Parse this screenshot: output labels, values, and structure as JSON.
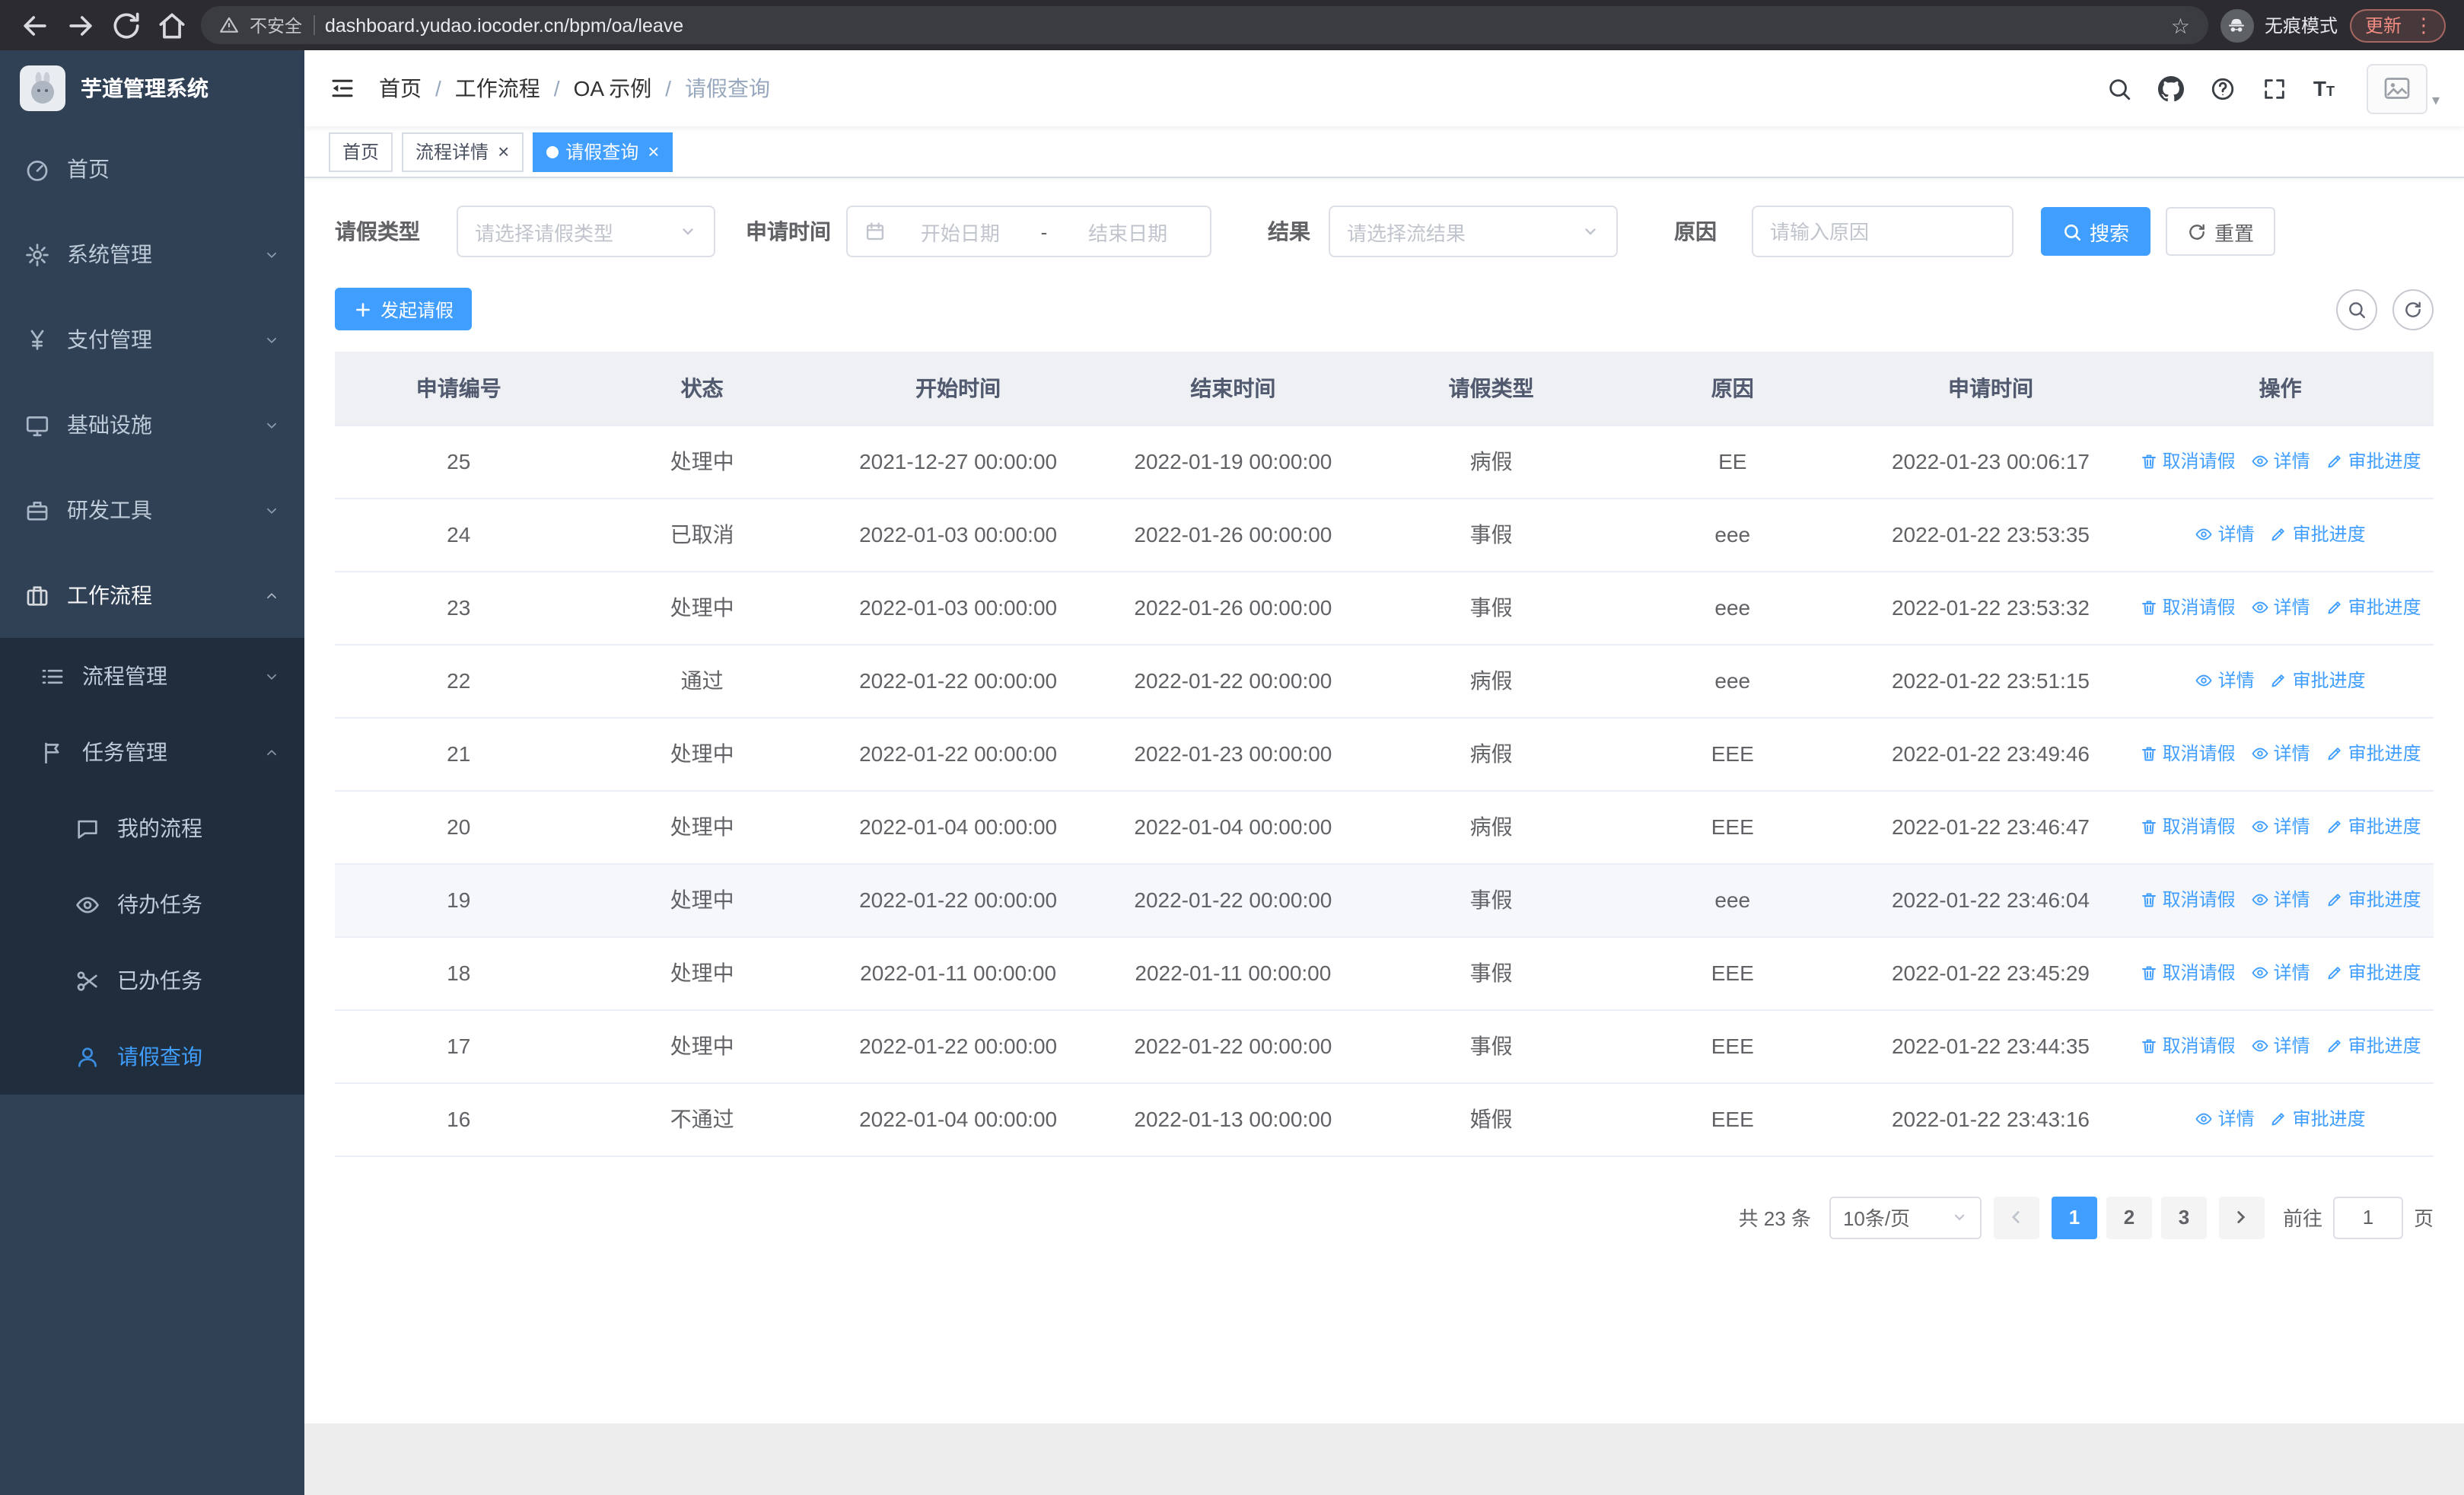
{
  "colors": {
    "accent": "#409eff",
    "sidebar_bg": "#304156",
    "sidebar_submenu_bg": "#1f2d3d",
    "update_pill": "#f28b82"
  },
  "browser": {
    "security_warning": "不安全",
    "url": "dashboard.yudao.iocoder.cn/bpm/oa/leave",
    "incognito_label": "无痕模式",
    "update_label": "更新"
  },
  "sidebar": {
    "logo_title": "芋道管理系统",
    "items": [
      {
        "icon": "dashboard",
        "label": "首页",
        "level": 1
      },
      {
        "icon": "gear",
        "label": "系统管理",
        "level": 1,
        "chevron": "down"
      },
      {
        "icon": "yen",
        "label": "支付管理",
        "level": 1,
        "chevron": "down"
      },
      {
        "icon": "monitor",
        "label": "基础设施",
        "level": 1,
        "chevron": "down"
      },
      {
        "icon": "tools",
        "label": "研发工具",
        "level": 1,
        "chevron": "down"
      },
      {
        "icon": "suitcase",
        "label": "工作流程",
        "level": 1,
        "chevron": "up",
        "parent_active": true
      },
      {
        "icon": "list",
        "label": "流程管理",
        "level": 2,
        "chevron": "down",
        "sub": true
      },
      {
        "icon": "flag",
        "label": "任务管理",
        "level": 2,
        "chevron": "up",
        "sub": true
      },
      {
        "icon": "chat",
        "label": "我的流程",
        "level": 3,
        "sub": true
      },
      {
        "icon": "eye",
        "label": "待办任务",
        "level": 3,
        "sub": true
      },
      {
        "icon": "scissors",
        "label": "已办任务",
        "level": 3,
        "sub": true
      },
      {
        "icon": "user",
        "label": "请假查询",
        "level": 3,
        "sub": true,
        "active": true
      }
    ]
  },
  "header": {
    "breadcrumb": [
      "首页",
      "工作流程",
      "OA 示例",
      "请假查询"
    ],
    "icons": [
      "search-icon",
      "github-icon",
      "question-icon",
      "fullscreen-icon",
      "font-size-icon",
      "avatar-placeholder"
    ]
  },
  "tabs": [
    {
      "label": "首页",
      "closable": false,
      "active": false
    },
    {
      "label": "流程详情",
      "closable": true,
      "active": false
    },
    {
      "label": "请假查询",
      "closable": true,
      "active": true
    }
  ],
  "filters": {
    "leave_type_label": "请假类型",
    "leave_type_placeholder": "请选择请假类型",
    "apply_time_label": "申请时间",
    "start_date_placeholder": "开始日期",
    "range_separator": "-",
    "end_date_placeholder": "结束日期",
    "result_label": "结果",
    "result_placeholder": "请选择流结果",
    "reason_label": "原因",
    "reason_placeholder": "请输入原因",
    "search_label": "搜索",
    "reset_label": "重置"
  },
  "toolbar": {
    "create_label": "发起请假"
  },
  "table": {
    "columns": [
      "申请编号",
      "状态",
      "开始时间",
      "结束时间",
      "请假类型",
      "原因",
      "申请时间",
      "操作"
    ],
    "rows": [
      {
        "id": "25",
        "status": "处理中",
        "start": "2021-12-27 00:00:00",
        "end": "2022-01-19 00:00:00",
        "type": "病假",
        "reason": "EE",
        "apply_time": "2022-01-23 00:06:17",
        "actions": [
          {
            "label": "取消请假",
            "icon": "delete"
          },
          {
            "label": "详情",
            "icon": "view"
          },
          {
            "label": "审批进度",
            "icon": "edit"
          }
        ]
      },
      {
        "id": "24",
        "status": "已取消",
        "start": "2022-01-03 00:00:00",
        "end": "2022-01-26 00:00:00",
        "type": "事假",
        "reason": "eee",
        "apply_time": "2022-01-22 23:53:35",
        "actions": [
          {
            "label": "详情",
            "icon": "view"
          },
          {
            "label": "审批进度",
            "icon": "edit"
          }
        ]
      },
      {
        "id": "23",
        "status": "处理中",
        "start": "2022-01-03 00:00:00",
        "end": "2022-01-26 00:00:00",
        "type": "事假",
        "reason": "eee",
        "apply_time": "2022-01-22 23:53:32",
        "actions": [
          {
            "label": "取消请假",
            "icon": "delete"
          },
          {
            "label": "详情",
            "icon": "view"
          },
          {
            "label": "审批进度",
            "icon": "edit"
          }
        ]
      },
      {
        "id": "22",
        "status": "通过",
        "start": "2022-01-22 00:00:00",
        "end": "2022-01-22 00:00:00",
        "type": "病假",
        "reason": "eee",
        "apply_time": "2022-01-22 23:51:15",
        "actions": [
          {
            "label": "详情",
            "icon": "view"
          },
          {
            "label": "审批进度",
            "icon": "edit"
          }
        ]
      },
      {
        "id": "21",
        "status": "处理中",
        "start": "2022-01-22 00:00:00",
        "end": "2022-01-23 00:00:00",
        "type": "病假",
        "reason": "EEE",
        "apply_time": "2022-01-22 23:49:46",
        "actions": [
          {
            "label": "取消请假",
            "icon": "delete"
          },
          {
            "label": "详情",
            "icon": "view"
          },
          {
            "label": "审批进度",
            "icon": "edit"
          }
        ]
      },
      {
        "id": "20",
        "status": "处理中",
        "start": "2022-01-04 00:00:00",
        "end": "2022-01-04 00:00:00",
        "type": "病假",
        "reason": "EEE",
        "apply_time": "2022-01-22 23:46:47",
        "actions": [
          {
            "label": "取消请假",
            "icon": "delete"
          },
          {
            "label": "详情",
            "icon": "view"
          },
          {
            "label": "审批进度",
            "icon": "edit"
          }
        ]
      },
      {
        "id": "19",
        "status": "处理中",
        "start": "2022-01-22 00:00:00",
        "end": "2022-01-22 00:00:00",
        "type": "事假",
        "reason": "eee",
        "apply_time": "2022-01-22 23:46:04",
        "highlighted": true,
        "actions": [
          {
            "label": "取消请假",
            "icon": "delete"
          },
          {
            "label": "详情",
            "icon": "view"
          },
          {
            "label": "审批进度",
            "icon": "edit"
          }
        ]
      },
      {
        "id": "18",
        "status": "处理中",
        "start": "2022-01-11 00:00:00",
        "end": "2022-01-11 00:00:00",
        "type": "事假",
        "reason": "EEE",
        "apply_time": "2022-01-22 23:45:29",
        "actions": [
          {
            "label": "取消请假",
            "icon": "delete"
          },
          {
            "label": "详情",
            "icon": "view"
          },
          {
            "label": "审批进度",
            "icon": "edit"
          }
        ]
      },
      {
        "id": "17",
        "status": "处理中",
        "start": "2022-01-22 00:00:00",
        "end": "2022-01-22 00:00:00",
        "type": "事假",
        "reason": "EEE",
        "apply_time": "2022-01-22 23:44:35",
        "actions": [
          {
            "label": "取消请假",
            "icon": "delete"
          },
          {
            "label": "详情",
            "icon": "view"
          },
          {
            "label": "审批进度",
            "icon": "edit"
          }
        ]
      },
      {
        "id": "16",
        "status": "不通过",
        "start": "2022-01-04 00:00:00",
        "end": "2022-01-13 00:00:00",
        "type": "婚假",
        "reason": "EEE",
        "apply_time": "2022-01-22 23:43:16",
        "actions": [
          {
            "label": "详情",
            "icon": "view"
          },
          {
            "label": "审批进度",
            "icon": "edit"
          }
        ]
      }
    ]
  },
  "pagination": {
    "total": "共 23 条",
    "page_size": "10条/页",
    "pages": [
      "1",
      "2",
      "3"
    ],
    "active_page": "1",
    "prev_disabled": true,
    "goto_label": "前往",
    "goto_value": "1",
    "page_unit": "页"
  }
}
